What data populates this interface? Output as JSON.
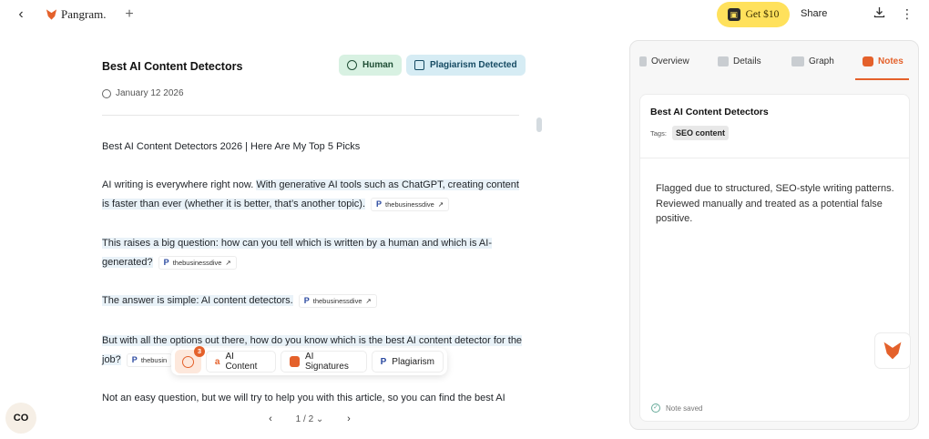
{
  "topbar": {
    "back_icon": "chevron-left-icon",
    "brand": "Pangram.",
    "new_tab_icon": "plus-icon",
    "get_label": "Get $10",
    "share_label": "Share",
    "download_icon": "download-icon",
    "more_icon": "more-vertical-icon"
  },
  "document": {
    "title": "Best AI Content Detectors",
    "badges": {
      "human": "Human",
      "plagiarism": "Plagiarism Detected"
    },
    "date": "January 12 2026",
    "heading_line": "Best AI Content Detectors 2026 | Here Are My Top 5 Picks",
    "source": "thebusinessdive",
    "source_truncated": "thebusin",
    "p1_plain": "AI writing is everywhere right now. ",
    "p1_hl": "With generative AI tools such as ChatGPT, creating content is faster than ever (whether it is better, that’s another topic).",
    "p2": "This raises a big question: how can you tell which is written by a human and which is AI-generated?",
    "p3": "The answer is simple: AI content detectors.",
    "p4": "But with all the options out there, how do you know which is the best AI content detector for the job?",
    "p5": "Not an easy question, but we will try to help you with this article, so you can find the best AI"
  },
  "floating_toolbar": {
    "count": "3",
    "ai_content": "AI Content",
    "ai_signatures": "AI Signatures",
    "plagiarism": "Plagiarism"
  },
  "pager": {
    "label": "1 / 2",
    "prev_icon": "chevron-left-icon",
    "next_icon": "chevron-right-icon"
  },
  "copilot_button": "CO",
  "panel": {
    "tabs": [
      "Overview",
      "Details",
      "Graph",
      "Notes"
    ],
    "active_tab": "Notes",
    "card_title": "Best AI Content Detectors",
    "tags_label": "Tags:",
    "tag": "SEO content",
    "note": "Flagged due to structured, SEO-style writing patterns. Reviewed manually and treated as a potential false positive.",
    "saved": "Note saved"
  },
  "colors": {
    "accent": "#e4612b",
    "highlight": "#e9f2f8",
    "get_button": "#ffe15c"
  }
}
